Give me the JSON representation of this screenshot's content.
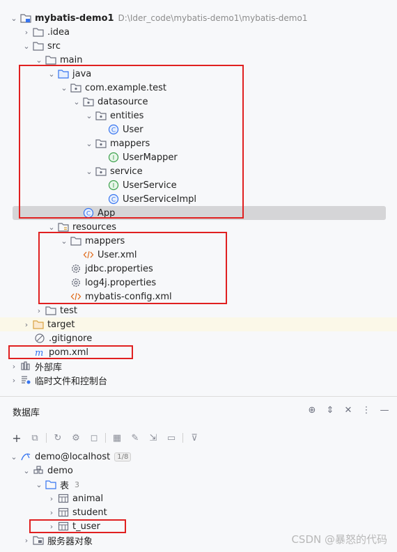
{
  "project_tree": {
    "root": {
      "label": "mybatis-demo1",
      "path": "D:\\Ider_code\\mybatis-demo1\\mybatis-demo1"
    },
    "idea": "idea",
    "src": "src",
    "main": "main",
    "java": "java",
    "package": "com.example.test",
    "datasource": "datasource",
    "entities": "entities",
    "user_class": "User",
    "mappers_pkg": "mappers",
    "user_mapper": "UserMapper",
    "service": "service",
    "user_service": "UserService",
    "user_service_impl": "UserServiceImpl",
    "app": "App",
    "resources": "resources",
    "res_mappers": "mappers",
    "user_xml": "User.xml",
    "jdbc_props": "jdbc.properties",
    "log4j_props": "log4j.properties",
    "mybatis_config": "mybatis-config.xml",
    "test": "test",
    "target": "target",
    "gitignore": ".gitignore",
    "pom": "pom.xml",
    "external_libs": "外部库",
    "scratches": "临时文件和控制台"
  },
  "database_panel": {
    "title": "数据库",
    "connection": "demo@localhost",
    "connection_badge": "1/8",
    "schema": "demo",
    "tables_folder": "表",
    "tables_count": "3",
    "tables": [
      "animal",
      "student",
      "t_user"
    ],
    "server_objects": "服务器对象"
  },
  "watermark": "CSDN @暴怒的代码"
}
